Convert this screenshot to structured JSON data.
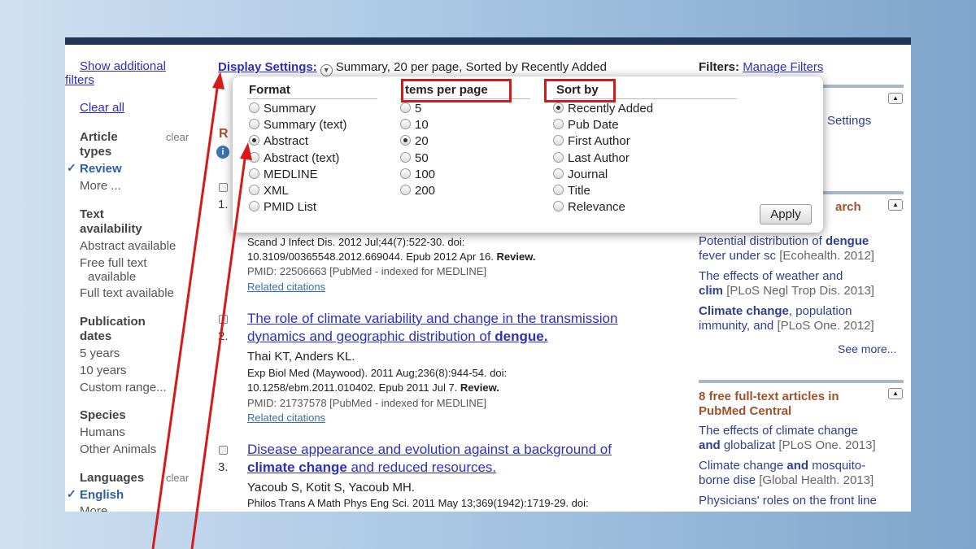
{
  "sidebar": {
    "show_filters_line1": "Show additional",
    "show_filters_line2": "filters",
    "clear_all": "Clear all",
    "article_types": {
      "heading_l1": "Article",
      "heading_l2": "types",
      "clear": "clear",
      "selected": "Review",
      "more": "More ..."
    },
    "text_availability": {
      "heading_l1": "Text",
      "heading_l2": "availability",
      "items": [
        "Abstract available",
        "Free full text",
        "available",
        "Full text available"
      ]
    },
    "publication_dates": {
      "heading_l1": "Publication",
      "heading_l2": "dates",
      "items": [
        "5 years",
        "10 years",
        "Custom range..."
      ]
    },
    "species": {
      "heading": "Species",
      "items": [
        "Humans",
        "Other Animals"
      ]
    },
    "languages": {
      "heading": "Languages",
      "clear": "clear",
      "selected": "English",
      "more": "More"
    }
  },
  "display_settings": {
    "label": "Display Settings:",
    "value": "Summary, 20 per page, Sorted by Recently Added"
  },
  "filters": {
    "label": "Filters:",
    "link": "Manage Filters"
  },
  "popup": {
    "format_heading": "Format",
    "format_options": [
      "Summary",
      "Summary (text)",
      "Abstract",
      "Abstract (text)",
      "MEDLINE",
      "XML",
      "PMID List"
    ],
    "format_selected": "Abstract",
    "items_heading": "tems per page",
    "items_options": [
      "5",
      "10",
      "20",
      "50",
      "100",
      "200"
    ],
    "items_selected": "20",
    "sort_heading": "Sort by",
    "sort_options": [
      "Recently Added",
      "Pub Date",
      "First Author",
      "Last Author",
      "Journal",
      "Title",
      "Relevance"
    ],
    "sort_selected": "Recently Added",
    "apply_label": "Apply"
  },
  "results_fragment": {
    "r_letter": "R",
    "num1": "1."
  },
  "results": [
    {
      "citation_l1": "Scand J Infect Dis. 2012 Jul;44(7):522-30. doi:",
      "citation_l2_plain": "10.3109/00365548.2012.669044. Epub 2012 Apr 16. ",
      "citation_l2_bold": "Review.",
      "pmid": "PMID: 22506663 [PubMed - indexed for MEDLINE]",
      "related": "Related citations"
    },
    {
      "num": "2.",
      "title_l1": "The role of climate variability and change in the transmission",
      "title_l2_plain": "dynamics and geographic distribution of ",
      "title_l2_bold": "dengue.",
      "authors": "Thai KT, Anders KL.",
      "citation_l1": "Exp Biol Med (Maywood). 2011 Aug;236(8):944-54. doi:",
      "citation_l2_plain": "10.1258/ebm.2011.010402. Epub 2011 Jul 7. ",
      "citation_l2_bold": "Review.",
      "pmid": "PMID: 21737578 [PubMed - indexed for MEDLINE]",
      "related": "Related citations"
    },
    {
      "num": "3.",
      "title_l1": "Disease appearance and evolution against a background of",
      "title_l2_bold": "climate change",
      "title_l2_plain": " and reduced resources.",
      "authors": "Yacoub S, Kotit S, Yacoub MH.",
      "citation_l1": "Philos Trans A Math Phys Eng Sci. 2011 May 13;369(1942):1719-29. doi:"
    }
  ],
  "right_panel": {
    "settings_fragment": "Settings",
    "search_fragment": "arch",
    "related_items": [
      {
        "plain": "Potential distribution of ",
        "bold": "dengue",
        "l2": "fever under sc",
        "src": "[Ecohealth. 2012]"
      },
      {
        "plain": "The effects of weather and",
        "bold": "",
        "l2": "clim",
        "src": "[PLoS Negl Trop Dis. 2013]"
      },
      {
        "bold": "Climate change",
        "plain": ", population",
        "l2": "immunity, and",
        "src": "[PLoS One. 2012]"
      }
    ],
    "see_more": "See more...",
    "pmc_heading_l1": "8 free full-text articles in",
    "pmc_heading_l2": "PubMed Central",
    "pmc_items": [
      {
        "l1": "The effects of climate change",
        "l2_bold": "and",
        "l2": " globalizat",
        "src": "[PLoS One. 2013]"
      },
      {
        "l1_plain": "Climate change ",
        "l1_bold": "and",
        "l1_tail": " mosquito-",
        "l2": "borne dise",
        "src": "[Global Health. 2013]"
      },
      {
        "l1": "Physicians' roles on the front line"
      }
    ]
  },
  "colors": {
    "accent_red": "#d61a1a",
    "link_blue": "#2e2ec0",
    "header_bar": "#1f3556",
    "heading_brown": "#a0522d"
  }
}
